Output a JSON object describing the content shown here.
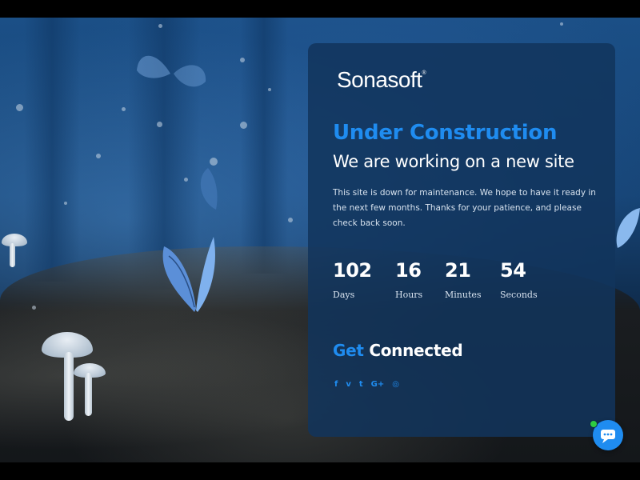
{
  "brand": {
    "name": "Sonasoft",
    "mark": "®"
  },
  "headline": {
    "title": "Under Construction",
    "subtitle": "We are working on a new site"
  },
  "description": "This site is down for maintenance. We hope to have it ready in the next few months. Thanks for your patience, and please check back soon.",
  "countdown": [
    {
      "value": "102",
      "label": "Days"
    },
    {
      "value": "16",
      "label": "Hours"
    },
    {
      "value": "21",
      "label": "Minutes"
    },
    {
      "value": "54",
      "label": "Seconds"
    }
  ],
  "connect": {
    "accent": "Get",
    "rest": " Connected"
  },
  "socials": [
    {
      "icon": "facebook-icon",
      "glyph": "f"
    },
    {
      "icon": "vimeo-icon",
      "glyph": "v"
    },
    {
      "icon": "twitter-icon",
      "glyph": "t"
    },
    {
      "icon": "google-plus-icon",
      "glyph": "G+"
    },
    {
      "icon": "dribbble-icon",
      "glyph": "◎"
    }
  ],
  "colors": {
    "accent": "#1f8cf0",
    "card": "#11345c",
    "online": "#2ecc40"
  }
}
